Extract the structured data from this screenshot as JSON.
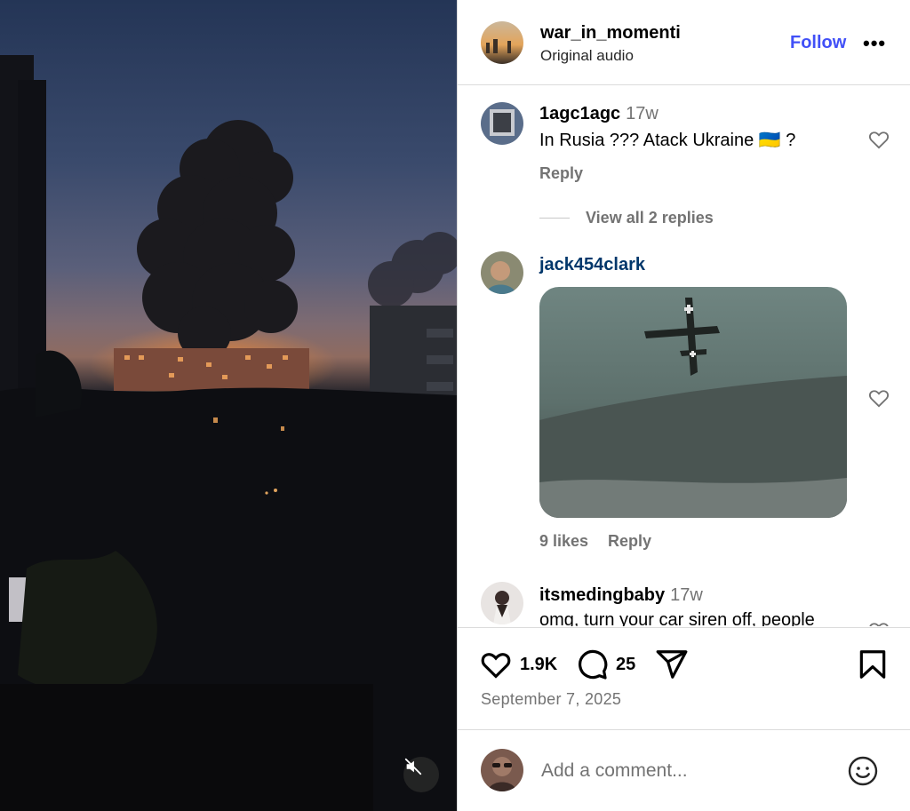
{
  "post": {
    "username": "war_in_momenti",
    "audio": "Original audio",
    "follow_label": "Follow",
    "more_label": "•••"
  },
  "comments": [
    {
      "username": "1agc1agc",
      "time": "17w",
      "text": "In Rusia ??? Atack Ukraine 🇺🇦 ?",
      "reply_label": "Reply",
      "view_replies_label": "View all 2 replies"
    },
    {
      "username": "jack454clark",
      "likes_label": "9 likes",
      "reply_label": "Reply",
      "attachment": "gif"
    },
    {
      "username": "itsmedingbaby",
      "time": "17w",
      "text": "omg, turn your car siren off, people"
    }
  ],
  "actions": {
    "likes": "1.9K",
    "comments": "25",
    "date": "September 7, 2025"
  },
  "composer": {
    "placeholder": "Add a comment..."
  },
  "icons": {
    "like": "heart-icon",
    "comment": "comment-bubble-icon",
    "share": "paper-plane-icon",
    "save": "bookmark-icon",
    "emoji": "smiley-icon",
    "mute": "muted-speaker-icon"
  },
  "colors": {
    "follow": "#4150f7",
    "mention": "#00376b",
    "secondary_text": "#737373"
  }
}
